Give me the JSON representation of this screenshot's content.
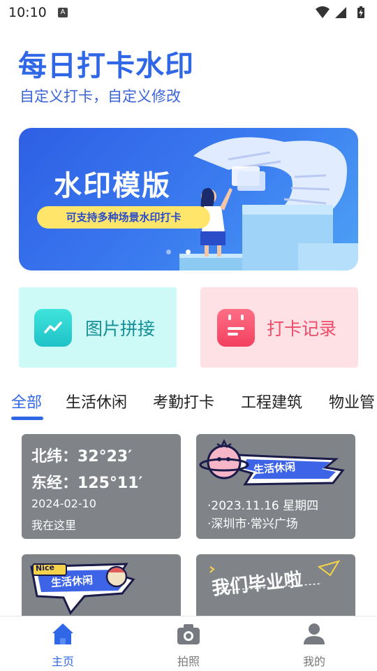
{
  "status_bar": {
    "time": "10:10",
    "badge": "A",
    "icons": [
      "wifi-icon",
      "signal-icon",
      "battery-icon"
    ]
  },
  "header": {
    "title": "每日打卡水印",
    "subtitle": "自定义打卡，自定义修改"
  },
  "banner": {
    "title": "水印模版",
    "pill": "可支持多种场景水印打卡",
    "slide_count": 2,
    "active_slide": 2
  },
  "quick_actions": {
    "puzzle_label": "图片拼接",
    "records_label": "打卡记录"
  },
  "tabs": [
    "全部",
    "生活休闲",
    "考勤打卡",
    "工程建筑",
    "物业管"
  ],
  "active_tab": 0,
  "templates": {
    "t1": {
      "lat": "北纬：32°23′",
      "lon": "东经：125°11′",
      "date": "2024-02-10",
      "location": "我在这里"
    },
    "t2": {
      "sticker": "生活休闲",
      "date_line": "·2023.11.16  星期四",
      "place_line": "·深圳市·常兴广场"
    },
    "t3": {
      "nice": "Nice",
      "sticker": "生活休闲"
    },
    "t4": {
      "sticker": "我们毕业啦"
    }
  },
  "bottom_nav": {
    "home": "主页",
    "camera": "拍照",
    "mine": "我的"
  },
  "colors": {
    "accent": "#2f67e6",
    "teal": "#1fc2c8",
    "pink": "#f2405f",
    "card_gray": "#808489"
  }
}
